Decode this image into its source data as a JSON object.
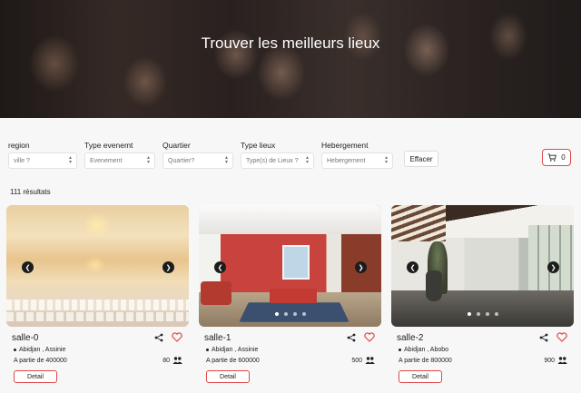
{
  "hero": {
    "title": "Trouver les meilleurs lieux"
  },
  "filters": [
    {
      "label": "region",
      "value": "ville ?"
    },
    {
      "label": "Type evenemt",
      "value": "Evenement"
    },
    {
      "label": "Quartier",
      "value": "Quartier?"
    },
    {
      "label": "Type lieux",
      "value": "Type(s) de Lieux ?"
    },
    {
      "label": "Hebergement",
      "value": "Hebergement"
    }
  ],
  "clear_label": "Effacer",
  "cart_count": "0",
  "results": "111 résultats",
  "cards": [
    {
      "name": "salle-0",
      "location": "Abidjan , Assinie",
      "price": "A partie de 400000",
      "capacity": "80",
      "detail_label": "Detail",
      "image": "ballroom"
    },
    {
      "name": "salle-1",
      "location": "Abidjan , Assinie",
      "price": "A partie de 600000",
      "capacity": "500",
      "detail_label": "Detail",
      "image": "red-dining-room"
    },
    {
      "name": "salle-2",
      "location": "Abidjan , Abobo",
      "price": "A partie de 800000",
      "capacity": "900",
      "detail_label": "Detail",
      "image": "modern-living-room"
    }
  ],
  "icons": {
    "cart": "cart-icon",
    "share": "share-icon",
    "heart": "heart-icon",
    "people": "people-icon",
    "prev": "chevron-left-icon",
    "next": "chevron-right-icon"
  },
  "colors": {
    "accent": "#e04848"
  }
}
